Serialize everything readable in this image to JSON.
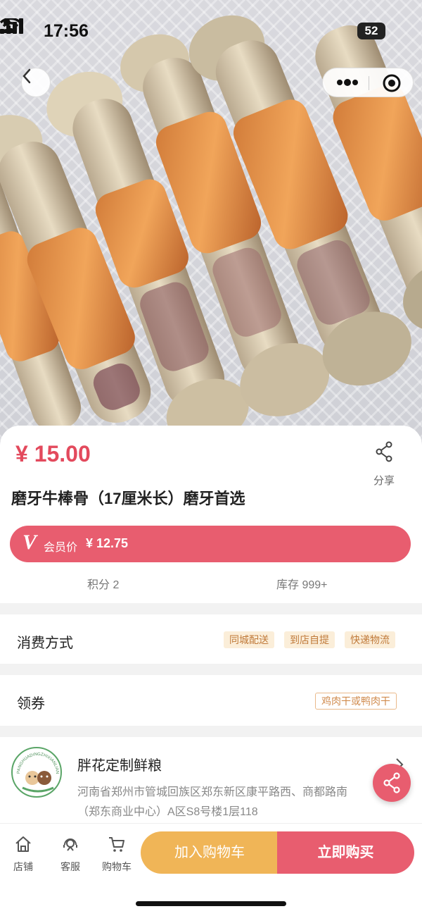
{
  "status_bar": {
    "time": "17:56",
    "battery": "52"
  },
  "product": {
    "price": "¥ 15.00",
    "share_label": "分享",
    "title": "磨牙牛棒骨（17厘米长）磨牙首选",
    "member": {
      "badge": "V",
      "label": "会员价",
      "price": "¥ 12.75"
    },
    "points": "积分 2",
    "stock": "库存 999+"
  },
  "consumption": {
    "label": "消费方式",
    "tags": [
      "同城配送",
      "到店自提",
      "快递物流"
    ]
  },
  "coupon": {
    "label": "领券",
    "tag": "鸡肉干或鸭肉干"
  },
  "store": {
    "name": "胖花定制鲜粮",
    "logo_text": "PANGHUADINGZHIXIANLIANG",
    "address_line1": "河南省郑州市管城回族区郑东新区康平路西、商都路南",
    "address_line2": "（郑东商业中心）A区S8号楼1层118"
  },
  "bottom_nav": {
    "tabs": [
      "店铺",
      "客服",
      "购物车"
    ],
    "add_to_cart": "加入购物车",
    "buy_now": "立即购买"
  },
  "colors": {
    "accent": "#e85d6f",
    "price": "#e34a5d",
    "cart": "#f0b557",
    "tag_bg": "#fbeed9"
  }
}
